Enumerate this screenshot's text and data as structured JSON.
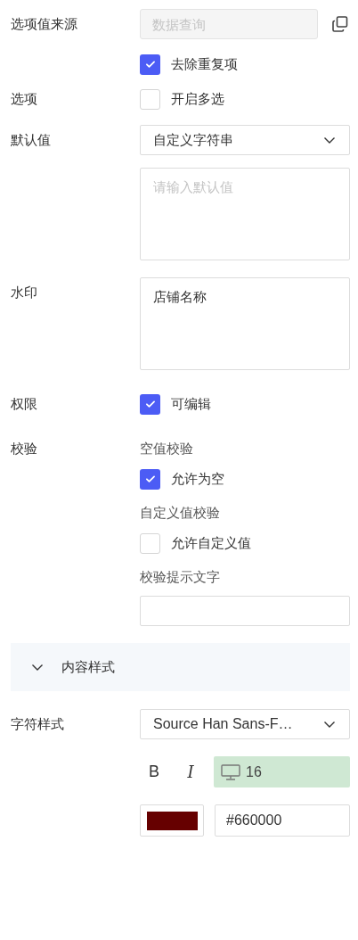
{
  "option_source": {
    "label": "选项值来源",
    "field": {
      "placeholder": "数据查询",
      "disabled": true
    },
    "dedupe": {
      "label": "去除重复项",
      "checked": true
    }
  },
  "options": {
    "label": "选项",
    "multi": {
      "label": "开启多选",
      "checked": false
    }
  },
  "default_value": {
    "label": "默认值",
    "select": "自定义字符串",
    "textarea": {
      "placeholder": "请输入默认值"
    }
  },
  "watermark": {
    "label": "水印",
    "value": "店铺名称"
  },
  "permission": {
    "label": "权限",
    "editable": {
      "label": "可编辑",
      "checked": true
    }
  },
  "validation": {
    "label": "校验",
    "groups": [
      {
        "title": "空值校验",
        "kind": "checkbox",
        "label": "允许为空",
        "checked": true
      },
      {
        "title": "自定义值校验",
        "kind": "checkbox",
        "label": "允许自定义值",
        "checked": false
      },
      {
        "title": "校验提示文字",
        "kind": "input"
      }
    ]
  },
  "content_style": {
    "title": "内容样式",
    "expanded": true
  },
  "char_style": {
    "label": "字符样式",
    "font": "Source Han Sans-F…",
    "bold": "B",
    "italic": "I",
    "size": "16",
    "color": "#660000"
  }
}
